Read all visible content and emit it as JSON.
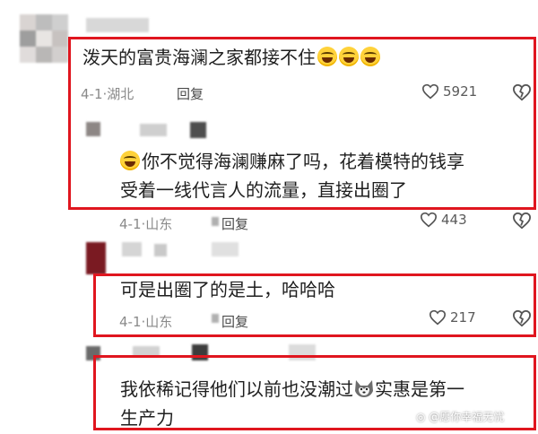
{
  "comments": [
    {
      "text": "泼天的富贵海澜之家都接不住",
      "date": "4-1",
      "location": "湖北",
      "reply_label": "回复",
      "likes": "5921"
    },
    {
      "text_line1": "你不觉得海澜赚麻了吗，花着模特的钱享",
      "text_line2": "受着一线代言人的流量，直接出圈了",
      "date": "4-1",
      "location": "山东",
      "reply_label": "回复",
      "likes": "443"
    },
    {
      "text": "可是出圈了的是土，哈哈哈",
      "date": "4-1",
      "location": "山东",
      "reply_label": "回复",
      "likes": "217"
    },
    {
      "text_line1": "我依稀记得他们以前也没潮过",
      "text_line1b": "实惠是第一",
      "text_line2": "生产力"
    }
  ],
  "watermark": "愿你幸福无忧",
  "highlight_color": "#e0161f",
  "icons": {
    "like": "heart-outline-icon",
    "dislike": "broken-heart-icon",
    "emoji": "laughing-crying-emoji",
    "sticker": "husky-emoji"
  }
}
